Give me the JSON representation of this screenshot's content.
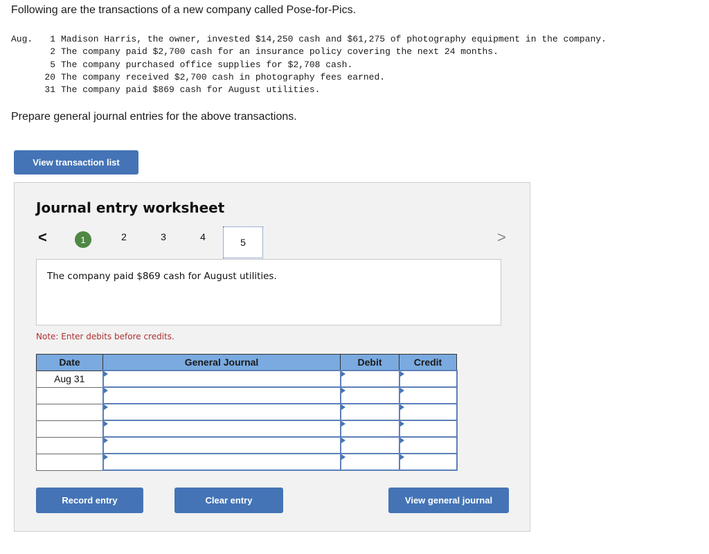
{
  "intro": "Following are the transactions of a new company called Pose-for-Pics.",
  "transactions": {
    "month": "Aug.",
    "items": [
      {
        "day": "1",
        "text": "Madison Harris, the owner, invested $14,250 cash and $61,275 of photography equipment in the company."
      },
      {
        "day": "2",
        "text": "The company paid $2,700 cash for an insurance policy covering the next 24 months."
      },
      {
        "day": "5",
        "text": "The company purchased office supplies for $2,708 cash."
      },
      {
        "day": "20",
        "text": "The company received $2,700 cash in photography fees earned."
      },
      {
        "day": "31",
        "text": "The company paid $869 cash for August utilities."
      }
    ]
  },
  "instruction": "Prepare general journal entries for the above transactions.",
  "view_transaction_list_label": "View transaction list",
  "worksheet": {
    "title": "Journal entry worksheet",
    "prev_glyph": "<",
    "next_glyph": ">",
    "steps": [
      "1",
      "2",
      "3",
      "4",
      "5"
    ],
    "completed_step": "1",
    "selected_step": "5",
    "description": "The company paid $869 cash for August utilities.",
    "note": "Note: Enter debits before credits.",
    "table": {
      "headers": [
        "Date",
        "General Journal",
        "Debit",
        "Credit"
      ],
      "rows": [
        {
          "date": "Aug 31",
          "account": "",
          "debit": "",
          "credit": ""
        },
        {
          "date": "",
          "account": "",
          "debit": "",
          "credit": ""
        },
        {
          "date": "",
          "account": "",
          "debit": "",
          "credit": ""
        },
        {
          "date": "",
          "account": "",
          "debit": "",
          "credit": ""
        },
        {
          "date": "",
          "account": "",
          "debit": "",
          "credit": ""
        },
        {
          "date": "",
          "account": "",
          "debit": "",
          "credit": ""
        }
      ]
    },
    "buttons": {
      "record": "Record entry",
      "clear": "Clear entry",
      "view_journal": "View general journal"
    }
  },
  "colors": {
    "button_blue": "#4474b6",
    "header_blue": "#7aaae0",
    "step_green": "#4f8744",
    "note_red": "#b03030"
  }
}
